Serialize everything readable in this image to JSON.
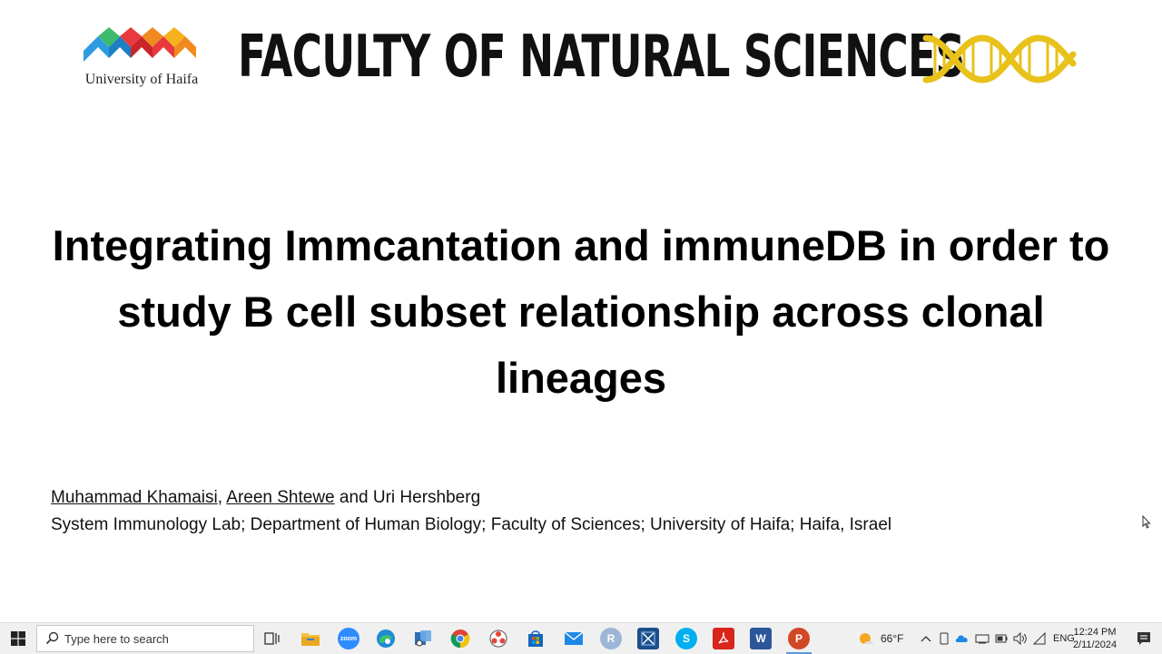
{
  "header": {
    "uni_logo_text": "University of Haifa",
    "faculty_title": "FACULTY OF NATURAL SCIENCES",
    "dna_icon": "dna-icon"
  },
  "slide": {
    "title": "Integrating Immcantation and immuneDB in order to study B cell subset relationship across clonal lineages",
    "authors": {
      "author1": "Muhammad Khamaisi",
      "sep1": ", ",
      "author2": "Areen Shtewe",
      "rest": " and Uri Hershberg"
    },
    "affiliation": "System Immunology Lab; Department of Human Biology; Faculty of Sciences; University of Haifa; Haifa, Israel"
  },
  "taskbar": {
    "search_placeholder": "Type here to search",
    "apps": [
      "task-view-icon",
      "file-explorer-icon",
      "zoom-icon",
      "edge-icon",
      "snipping-tool-icon",
      "chrome-icon",
      "davinci-icon",
      "store-icon",
      "mail-icon",
      "r-icon",
      "vm-icon",
      "skype-icon",
      "acrobat-icon",
      "word-icon",
      "powerpoint-icon"
    ],
    "zoom_label": "zoom",
    "r_label": "R",
    "skype_label": "S",
    "word_label": "W",
    "powerpoint_label": "P",
    "weather": "66°F",
    "language": "ENG",
    "time": "12:24 PM",
    "date": "2/11/2024"
  },
  "colors": {
    "dna_gold": "#e8c21a",
    "taskbar_bg": "#f0f0f0",
    "logo_blue": "#2e9be0",
    "logo_red": "#e8393c",
    "logo_orange": "#f08a1e",
    "logo_green": "#3dbb6c"
  }
}
